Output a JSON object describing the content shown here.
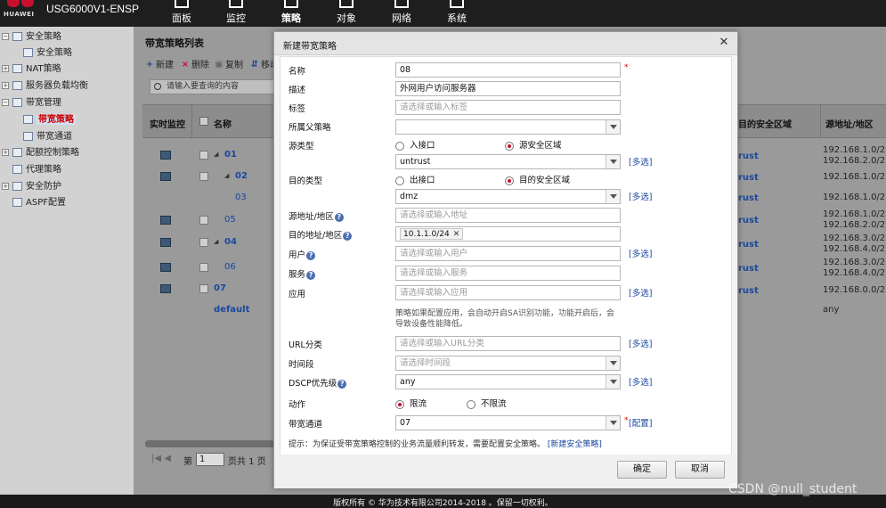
{
  "app": {
    "brand": "HUAWEI",
    "device_name": "USG6000V1-ENSP",
    "nav": [
      {
        "label": "面板",
        "icon": "dashboard-icon"
      },
      {
        "label": "监控",
        "icon": "monitor-icon"
      },
      {
        "label": "策略",
        "icon": "policy-icon"
      },
      {
        "label": "对象",
        "icon": "object-icon"
      },
      {
        "label": "网络",
        "icon": "network-icon"
      },
      {
        "label": "系统",
        "icon": "system-icon"
      }
    ],
    "active_nav": "策略"
  },
  "sidebar": {
    "items": [
      {
        "label": "安全策略"
      },
      {
        "label": "安全策略"
      },
      {
        "label": "NAT策略"
      },
      {
        "label": "服务器负载均衡"
      },
      {
        "label": "带宽管理"
      },
      {
        "label": "带宽策略"
      },
      {
        "label": "带宽通道"
      },
      {
        "label": "配额控制策略"
      },
      {
        "label": "代理策略"
      },
      {
        "label": "安全防护"
      },
      {
        "label": "ASPF配置"
      }
    ]
  },
  "list_panel": {
    "title": "带宽策略列表",
    "toolbar": {
      "add": "新建",
      "delete": "删除",
      "copy": "复制",
      "move": "移动"
    },
    "search_placeholder": "请输入要查询的内容",
    "columns": {
      "monitor": "实时监控",
      "name": "名称",
      "dest_zone": "目的安全区域",
      "src_addr": "源地址/地区"
    },
    "rows": [
      {
        "name": "01",
        "dest_zone": "rust",
        "src_addr": "192.168.1.0/2...",
        "src_addr2": "192.168.2.0/2..."
      },
      {
        "name": "02",
        "dest_zone": "rust",
        "src_addr": "192.168.1.0/2..."
      },
      {
        "name": "03",
        "dest_zone": "rust",
        "src_addr": "192.168.1.0/2..."
      },
      {
        "name": "05",
        "dest_zone": "rust",
        "src_addr": "192.168.1.0/2...",
        "src_addr2": "192.168.2.0/2..."
      },
      {
        "name": "04",
        "dest_zone": "rust",
        "src_addr": "192.168.3.0/2...",
        "src_addr2": "192.168.4.0/2..."
      },
      {
        "name": "06",
        "dest_zone": "rust",
        "src_addr": "192.168.3.0/2...",
        "src_addr2": "192.168.4.0/2..."
      },
      {
        "name": "07",
        "dest_zone": "rust",
        "src_addr": "192.168.0.0/2..."
      },
      {
        "name": "default",
        "dest_zone": "",
        "src_addr": "any"
      }
    ],
    "pager": {
      "page_prefix": "第",
      "page_value": "1",
      "page_total": "页共 1 页"
    }
  },
  "dialog": {
    "title": "新建带宽策略",
    "fields": {
      "name": {
        "label": "名称",
        "value": "08"
      },
      "desc": {
        "label": "描述",
        "value": "外网用户访问服务器"
      },
      "tag": {
        "label": "标签",
        "placeholder": "请选择或输入标签"
      },
      "parent": {
        "label": "所属父策略",
        "value": ""
      },
      "src_type": {
        "label": "源类型",
        "opt1": "入接口",
        "opt2": "源安全区域",
        "value": "untrust"
      },
      "dst_type": {
        "label": "目的类型",
        "opt1": "出接口",
        "opt2": "目的安全区域",
        "value": "dmz"
      },
      "src_addr": {
        "label": "源地址/地区",
        "placeholder": "请选择或输入地址"
      },
      "dst_addr": {
        "label": "目的地址/地区",
        "tag": "10.1.1.0/24"
      },
      "user": {
        "label": "用户",
        "placeholder": "请选择或输入用户"
      },
      "service": {
        "label": "服务",
        "placeholder": "请选择或输入服务"
      },
      "app": {
        "label": "应用",
        "placeholder": "请选择或输入应用"
      },
      "app_note": "策略如果配置应用，会自动开启SA识别功能，功能开启后，会导致设备性能降低。",
      "url": {
        "label": "URL分类",
        "placeholder": "请选择或输入URL分类"
      },
      "time": {
        "label": "时间段",
        "placeholder": "请选择时间段"
      },
      "dscp": {
        "label": "DSCP优先级",
        "value": "any"
      },
      "action": {
        "label": "动作",
        "opt1": "限流",
        "opt2": "不限流"
      },
      "channel": {
        "label": "带宽通道",
        "value": "07"
      }
    },
    "multi_select": "[多选]",
    "configure": "[配置]",
    "required_mark": "*",
    "tip": "提示：为保证受带宽策略控制的业务流量顺利转发，需要配置安全策略。",
    "tip_link": "[新建安全策略]",
    "ok": "确定",
    "cancel": "取消"
  },
  "footer": {
    "copyright": "版权所有 © 华为技术有限公司2014-2018 。保留一切权利。",
    "watermark": "CSDN @null_student"
  },
  "colors": {
    "accent": "#c8102e",
    "link": "#1a48a0",
    "topbar": "#1e1e1e"
  }
}
